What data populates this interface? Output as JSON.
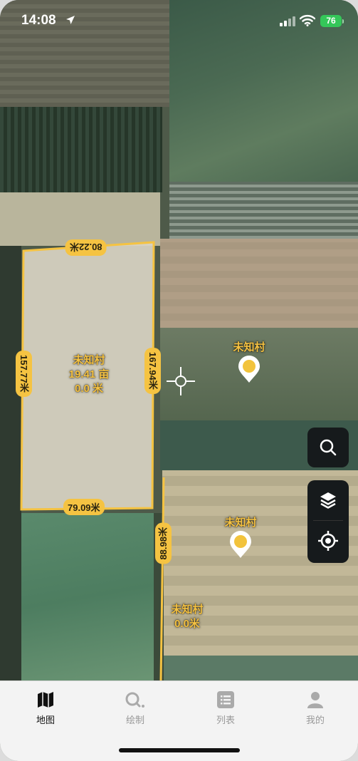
{
  "status_bar": {
    "time": "14:08",
    "battery": "76",
    "battery_color": "#34c759"
  },
  "map": {
    "accent_color": "#f5c342",
    "parcel": {
      "name": "未知村",
      "area": "19.41 亩",
      "length": "0.0 米",
      "edge_top": "80.22米",
      "edge_left": "157.77米",
      "edge_right": "167.94米",
      "edge_bottom": "79.09米"
    },
    "drawing_line": {
      "edge": "88.98米"
    },
    "points": [
      {
        "name": "未知村"
      },
      {
        "name": "未知村"
      }
    ],
    "point_label": {
      "name": "未知村",
      "length": "0.0米"
    }
  },
  "controls": {
    "icons": [
      "search-icon",
      "layers-icon",
      "locate-icon"
    ]
  },
  "tab_bar": {
    "tabs": [
      {
        "label": "地图",
        "icon": "map-icon",
        "active": true
      },
      {
        "label": "绘制",
        "icon": "draw-icon",
        "active": false
      },
      {
        "label": "列表",
        "icon": "list-icon",
        "active": false
      },
      {
        "label": "我的",
        "icon": "profile-icon",
        "active": false
      }
    ]
  }
}
